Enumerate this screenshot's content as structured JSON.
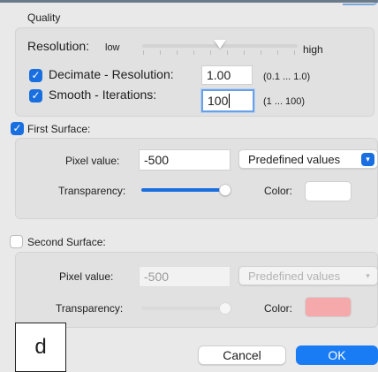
{
  "quality": {
    "title": "Quality",
    "resolution": {
      "label": "Resolution:",
      "low": "low",
      "high": "high",
      "level": 0.5
    },
    "decimate": {
      "label": "Decimate - Resolution:",
      "value": "1.00",
      "range": "(0.1 ... 1.0)",
      "checked": true
    },
    "smooth": {
      "label": "Smooth - Iterations:",
      "value": "100",
      "range": "(1 ... 100)",
      "checked": true
    }
  },
  "first_surface": {
    "label": "First Surface:",
    "checked": true,
    "pixel_value_label": "Pixel value:",
    "pixel_value": "-500",
    "predefined": "Predefined values",
    "transparency_label": "Transparency:",
    "transparency": 1.0,
    "color_label": "Color:",
    "color": "#ffffff"
  },
  "second_surface": {
    "label": "Second Surface:",
    "checked": false,
    "pixel_value_label": "Pixel value:",
    "pixel_value": "-500",
    "predefined": "Predefined values",
    "transparency_label": "Transparency:",
    "transparency": 1.0,
    "color_label": "Color:",
    "color": "#f5a9ab"
  },
  "overlay": {
    "letter": "d"
  },
  "buttons": {
    "cancel": "Cancel",
    "ok": "OK"
  },
  "icons": {
    "check": "checkmark-icon",
    "select_arrow": "chevron-down-icon"
  }
}
